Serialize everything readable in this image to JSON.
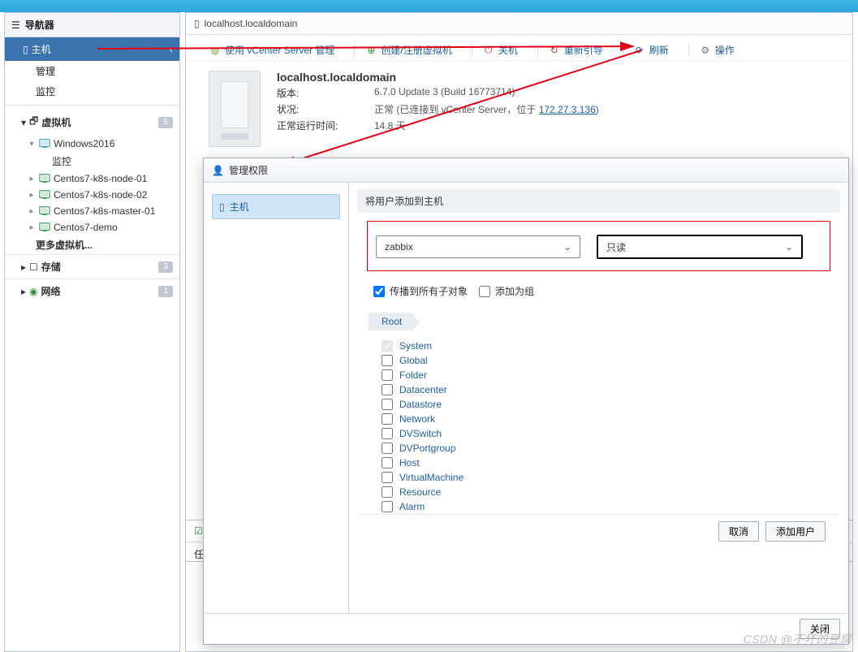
{
  "navigator": {
    "title": "导航器",
    "host_label": "主机",
    "sub_manage": "管理",
    "sub_monitor": "监控",
    "vm_header": "虚拟机",
    "vm_badge": "5",
    "trees": [
      {
        "name": "Windows2016",
        "expanded": true,
        "sub": "监控",
        "color": "#3aa3c9"
      },
      {
        "name": "Centos7-k8s-node-01",
        "expanded": false,
        "color": "#3fa05a"
      },
      {
        "name": "Centos7-k8s-node-02",
        "expanded": false,
        "color": "#3fa05a"
      },
      {
        "name": "Centos7-k8s-master-01",
        "expanded": false,
        "color": "#3fa05a"
      },
      {
        "name": "Centos7-demo",
        "expanded": false,
        "color": "#3fa05a"
      }
    ],
    "more_vms": "更多虚拟机...",
    "storage": "存储",
    "storage_badge": "3",
    "network": "网络",
    "network_badge": "1"
  },
  "breadcrumb": {
    "host": "localhost.localdomain"
  },
  "toolbar": {
    "vcenter": "使用 vCenter Server 管理",
    "create": "创建/注册虚拟机",
    "shutdown": "关机",
    "reboot": "重新引导",
    "refresh": "刷新",
    "actions": "操作"
  },
  "hostInfo": {
    "title": "localhost.localdomain",
    "version_k": "版本:",
    "version_v": "6.7.0 Update 3 (Build 16773714)",
    "state_k": "状况:",
    "state_v_prefix": "正常 (已连接到 vCenter Server，位于 ",
    "state_link": "172.27.3.136",
    "state_v_suffix": ")",
    "uptime_k": "正常运行时间:",
    "uptime_v": "14.8 天"
  },
  "dialog": {
    "title": "管理权限",
    "side_item": "主机",
    "panel_title": "将用户添加到主机",
    "user_value": "zabbix",
    "role_value": "只读",
    "chk_propagate": "传播到所有子对象",
    "chk_addgroup": "添加为组",
    "crumb_root": "Root",
    "perms": [
      {
        "name": "System",
        "checked": true,
        "disabled": true
      },
      {
        "name": "Global"
      },
      {
        "name": "Folder"
      },
      {
        "name": "Datacenter"
      },
      {
        "name": "Datastore"
      },
      {
        "name": "Network"
      },
      {
        "name": "DVSwitch"
      },
      {
        "name": "DVPortgroup"
      },
      {
        "name": "Host"
      },
      {
        "name": "VirtualMachine"
      },
      {
        "name": "Resource"
      },
      {
        "name": "Alarm"
      }
    ],
    "btn_cancel": "取消",
    "btn_adduser": "添加用户",
    "btn_close": "关闭"
  },
  "taskpane": {
    "header_short": "任"
  },
  "watermark": "CSDN @不坏的豆腐"
}
